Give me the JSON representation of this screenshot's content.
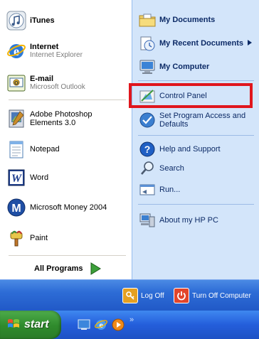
{
  "left_menu": {
    "pinned": [
      {
        "title": "iTunes",
        "subtitle": "",
        "icon": "itunes-icon"
      },
      {
        "title": "Internet",
        "subtitle": "Internet Explorer",
        "icon": "internet-explorer-icon"
      },
      {
        "title": "E-mail",
        "subtitle": "Microsoft Outlook",
        "icon": "outlook-icon"
      }
    ],
    "recent": [
      {
        "label": "Adobe Photoshop Elements 3.0",
        "icon": "photoshop-elements-icon"
      },
      {
        "label": "Notepad",
        "icon": "notepad-icon"
      },
      {
        "label": "Word",
        "icon": "word-icon"
      },
      {
        "label": "Microsoft Money 2004",
        "icon": "money-icon"
      },
      {
        "label": "Paint",
        "icon": "paint-icon"
      }
    ],
    "all_programs": "All Programs"
  },
  "right_menu": {
    "my_documents": "My Documents",
    "my_recent_documents": "My Recent Documents",
    "my_computer": "My Computer",
    "control_panel": "Control Panel",
    "set_program_access": "Set Program Access and Defaults",
    "help_support": "Help and Support",
    "search": "Search",
    "run": "Run...",
    "about_hp": "About my HP PC"
  },
  "bottom": {
    "log_off": "Log Off",
    "turn_off": "Turn Off Computer"
  },
  "taskbar": {
    "start": "start"
  },
  "colors": {
    "highlight": "#e0161d",
    "right_panel": "#d3e5fa",
    "start_green": "#2f8a2c",
    "xp_blue": "#245edb"
  }
}
